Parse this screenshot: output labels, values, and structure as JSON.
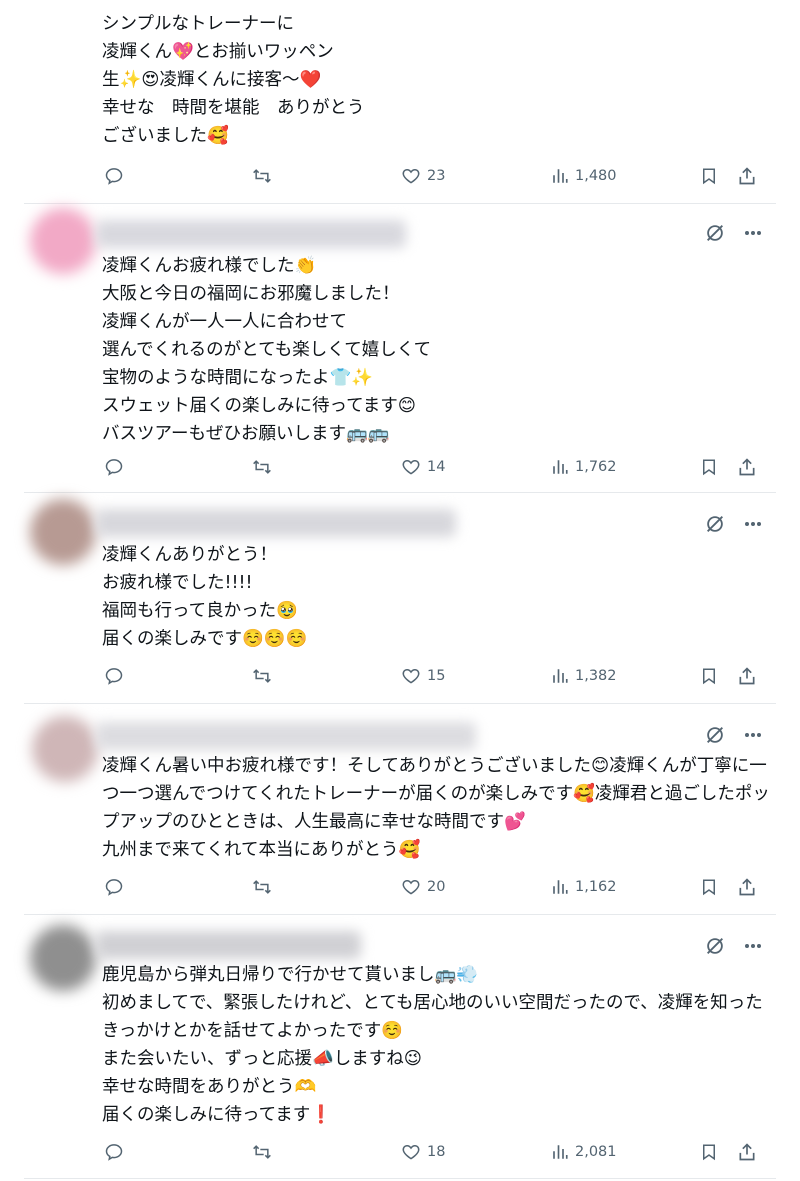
{
  "posts": [
    {
      "text": "シンプルなトレーナーに\n凌輝くん💖とお揃いワッペン\n生✨😍凌輝くんに接客〜❤️\n幸せな　時間を堪能　ありがとう\nございました🥰",
      "likes": "23",
      "views": "1,480",
      "avatar_color": "#ffffff",
      "name_color": "#ffffff",
      "has_header": false
    },
    {
      "text": "凌輝くんお疲れ様でした👏\n大阪と今日の福岡にお邪魔しました！\n凌輝くんが一人一人に合わせて\n選んでくれるのがとても楽しくて嬉しくて\n宝物のような時間になったよ👕✨\nスウェット届くの楽しみに待ってます😊\nバスツアーもぜひお願いします🚌🚌",
      "likes": "14",
      "views": "1,762",
      "avatar_color": "#f2a9c6",
      "name_color": "#d8d8de",
      "has_header": true
    },
    {
      "text": "凌輝くんありがとう！\nお疲れ様でした!!!!\n福岡も行って良かった🥹\n届くの楽しみです☺️☺️☺️",
      "likes": "15",
      "views": "1,382",
      "avatar_color": "#b79a93",
      "name_color": "#d7d7dc",
      "has_header": true
    },
    {
      "text": "凌輝くん暑い中お疲れ様です！そしてありがとうございました😊凌輝くんが丁寧に一つ一つ選んでつけてくれたトレーナーが届くのが楽しみです🥰凌輝君と過ごしたポップアップのひとときは、人生最高に幸せな時間です💕\n九州まで来てくれて本当にありがとう🥰",
      "likes": "20",
      "views": "1,162",
      "avatar_color": "#cfb6b7",
      "name_color": "#dcdce0",
      "has_header": true
    },
    {
      "text": "鹿児島から弾丸日帰りで行かせて貰いまし🚌💨\n初めましてで、緊張したけれど、とても居心地のいい空間だったので、凌輝を知ったきっかけとかを話せてよかったです☺️\nまた会いたい、ずっと応援📣しますね😉\n幸せな時間をありがとう🫶\n届くの楽しみに待ってます❗",
      "likes": "18",
      "views": "2,081",
      "avatar_color": "#8f8f8f",
      "name_color": "#d0d0d4",
      "has_header": true
    }
  ],
  "icons": {
    "reply": "reply-icon",
    "repost": "repost-icon",
    "like": "heart-icon",
    "views": "views-icon",
    "bookmark": "bookmark-icon",
    "share": "share-icon",
    "grok": "grok-icon",
    "more": "more-icon"
  }
}
